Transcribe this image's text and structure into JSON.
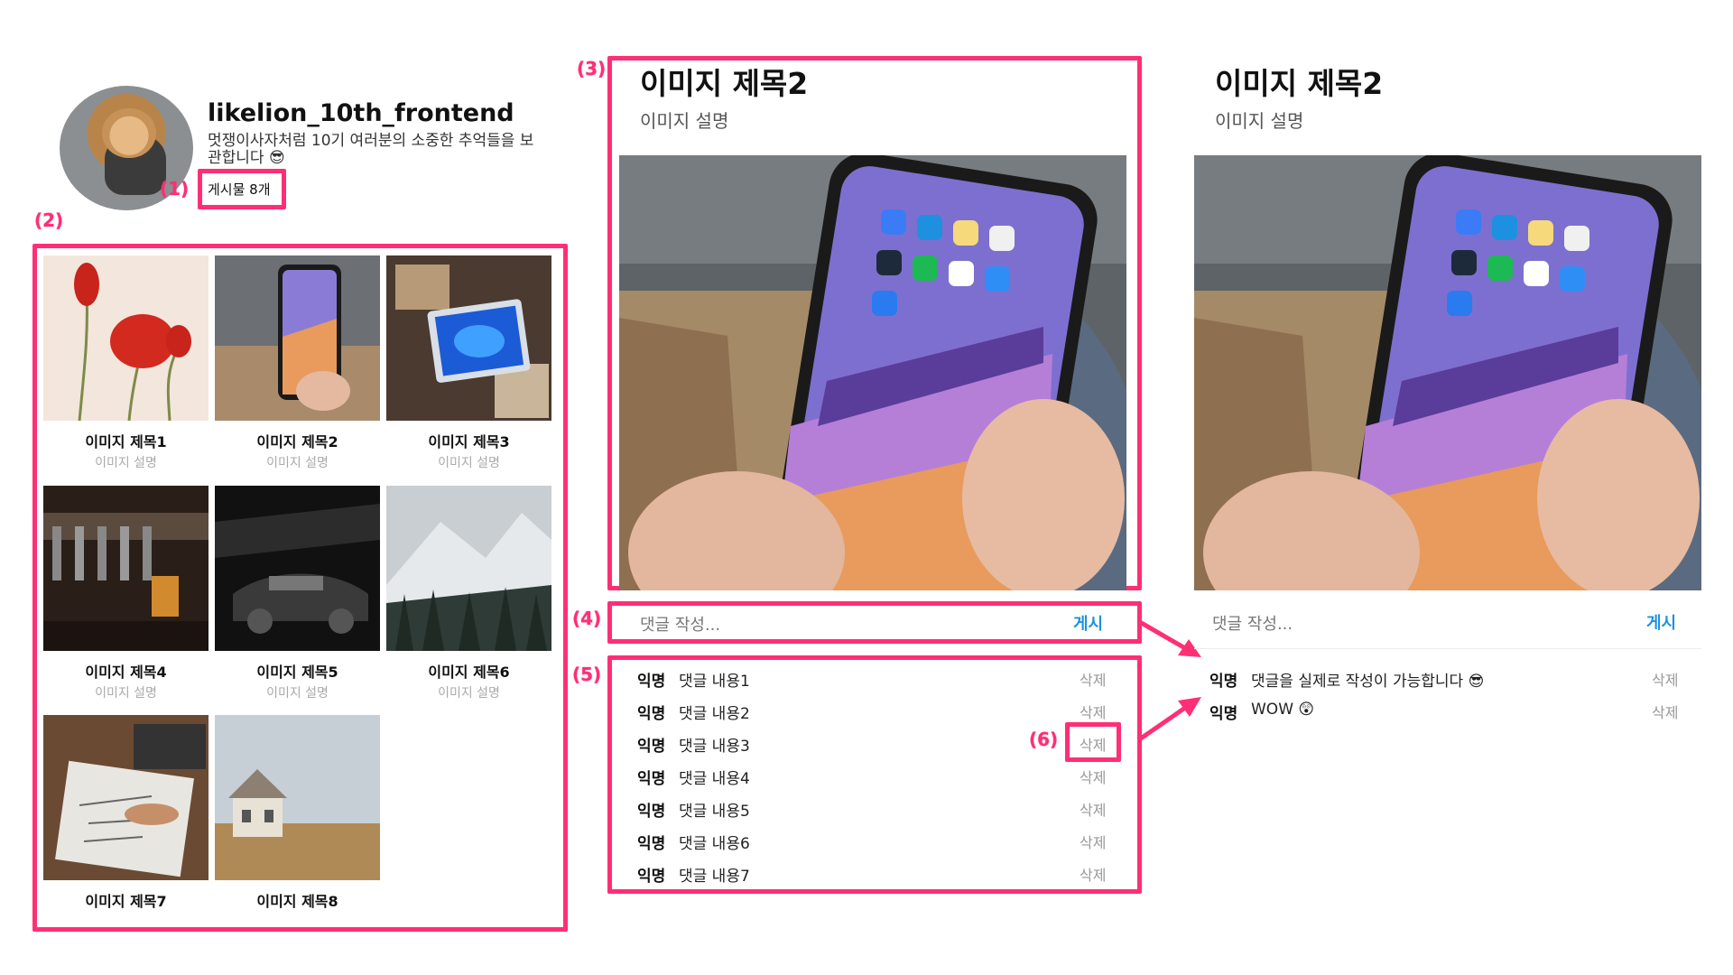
{
  "profile": {
    "username": "likelion_10th_frontend",
    "bio": "멋쟁이사자처럼 10기 여러분의 소중한 추억들을 보관합니다 😎",
    "post_count": "게시물 8개"
  },
  "markers": [
    "(1)",
    "(2)",
    "(3)",
    "(4)",
    "(5)",
    "(6)"
  ],
  "gallery": [
    {
      "title": "이미지 제목1",
      "desc": "이미지 설명"
    },
    {
      "title": "이미지 제목2",
      "desc": "이미지 설명"
    },
    {
      "title": "이미지 제목3",
      "desc": "이미지 설명"
    },
    {
      "title": "이미지 제목4",
      "desc": "이미지 설명"
    },
    {
      "title": "이미지 제목5",
      "desc": "이미지 설명"
    },
    {
      "title": "이미지 제목6",
      "desc": "이미지 설명"
    },
    {
      "title": "이미지 제목7",
      "desc": ""
    },
    {
      "title": "이미지 제목8",
      "desc": ""
    }
  ],
  "detail_left": {
    "title": "이미지 제목2",
    "desc": "이미지 설명",
    "comment_placeholder": "댓글 작성...",
    "post_label": "게시",
    "comments": [
      {
        "author": "익명",
        "text": "댓글 내용1",
        "delete": "삭제"
      },
      {
        "author": "익명",
        "text": "댓글 내용2",
        "delete": "삭제"
      },
      {
        "author": "익명",
        "text": "댓글 내용3",
        "delete": "삭제"
      },
      {
        "author": "익명",
        "text": "댓글 내용4",
        "delete": "삭제"
      },
      {
        "author": "익명",
        "text": "댓글 내용5",
        "delete": "삭제"
      },
      {
        "author": "익명",
        "text": "댓글 내용6",
        "delete": "삭제"
      },
      {
        "author": "익명",
        "text": "댓글 내용7",
        "delete": "삭제"
      }
    ]
  },
  "detail_right": {
    "title": "이미지 제목2",
    "desc": "이미지 설명",
    "comment_placeholder": "댓글 작성...",
    "post_label": "게시",
    "comments": [
      {
        "author": "익명",
        "text": "댓글을 실제로 작성이 가능합니다 😎",
        "delete": "삭제"
      },
      {
        "author": "익명",
        "text": "WOW 😲",
        "delete": "삭제"
      }
    ]
  },
  "colors": {
    "highlight": "#ff2f74",
    "link_blue": "#1e90e0",
    "muted_text": "#999999"
  }
}
